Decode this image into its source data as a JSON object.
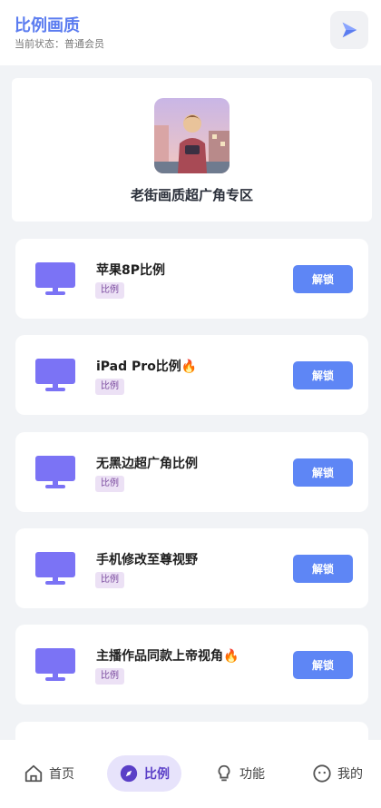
{
  "header": {
    "title": "比例画质",
    "status": "当前状态：普通会员",
    "play_icon": "play-icon"
  },
  "hero": {
    "title": "老街画质超广角专区",
    "image_icon": "avatar-illustration"
  },
  "items": [
    {
      "title": "苹果8P比例",
      "tag": "比例",
      "button": "解锁",
      "icon": "monitor-icon"
    },
    {
      "title": "iPad Pro比例🔥",
      "tag": "比例",
      "button": "解锁",
      "icon": "monitor-icon"
    },
    {
      "title": "无黑边超广角比例",
      "tag": "比例",
      "button": "解锁",
      "icon": "monitor-icon"
    },
    {
      "title": "手机修改至尊视野",
      "tag": "比例",
      "button": "解锁",
      "icon": "monitor-icon"
    },
    {
      "title": "主播作品同款上帝视角🔥",
      "tag": "比例",
      "button": "解锁",
      "icon": "monitor-icon"
    }
  ],
  "tabs": [
    {
      "label": "首页",
      "icon": "home-icon",
      "active": false
    },
    {
      "label": "比例",
      "icon": "compass-icon",
      "active": true
    },
    {
      "label": "功能",
      "icon": "lightbulb-icon",
      "active": false
    },
    {
      "label": "我的",
      "icon": "face-icon",
      "active": false
    }
  ],
  "colors": {
    "accent": "#5b7cf0",
    "button": "#5e86f5",
    "monitor": "#7b73f5",
    "tag_bg": "#ece1f5",
    "tab_active_bg": "#e7e3fb"
  }
}
